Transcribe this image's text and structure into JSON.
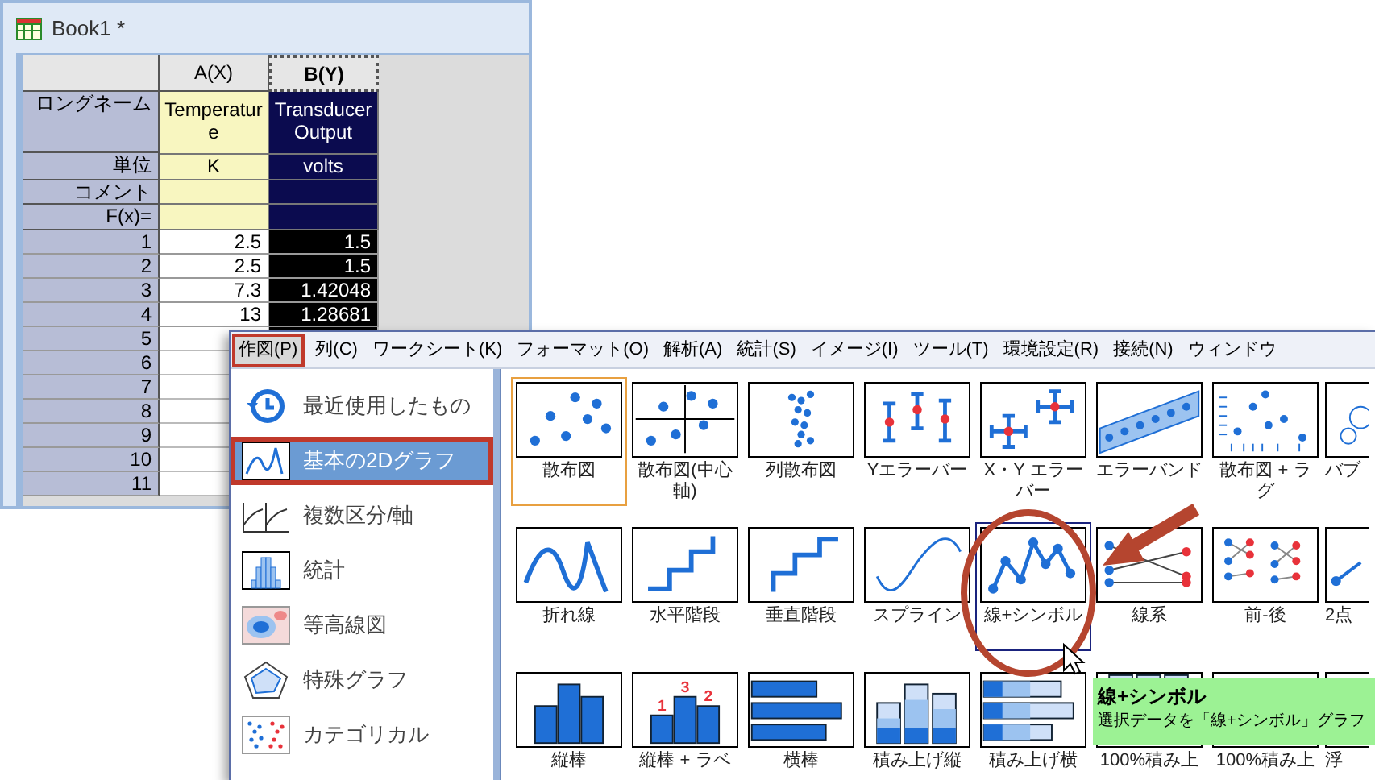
{
  "worksheet": {
    "title": "Book1 *",
    "row_labels": [
      "ロングネーム",
      "単位",
      "コメント",
      "F(x)="
    ],
    "columns": [
      {
        "name": "A(X)",
        "selected": false,
        "long_name": "Temperature",
        "units": "K",
        "values": [
          "2.5",
          "2.5",
          "7.3",
          "13"
        ]
      },
      {
        "name": "B(Y)",
        "selected": true,
        "long_name": "Transducer Output",
        "units": "volts",
        "values": [
          "1.5",
          "1.5",
          "1.42048",
          "1.28681"
        ]
      }
    ],
    "row_numbers": [
      "1",
      "2",
      "3",
      "4",
      "5",
      "6",
      "7",
      "8",
      "9",
      "10",
      "11"
    ]
  },
  "menu": {
    "items": [
      {
        "label": "作図(P)",
        "selected": true
      },
      {
        "label": "列(C)",
        "selected": false
      },
      {
        "label": "ワークシート(K)",
        "selected": false
      },
      {
        "label": "フォーマット(O)",
        "selected": false
      },
      {
        "label": "解析(A)",
        "selected": false
      },
      {
        "label": "統計(S)",
        "selected": false
      },
      {
        "label": "イメージ(I)",
        "selected": false
      },
      {
        "label": "ツール(T)",
        "selected": false
      },
      {
        "label": "環境設定(R)",
        "selected": false
      },
      {
        "label": "接続(N)",
        "selected": false
      },
      {
        "label": "ウィンドウ",
        "selected": false
      }
    ],
    "categories": [
      {
        "label": "最近使用したもの",
        "kind": "recent",
        "selected": false
      },
      {
        "label": "基本の2Dグラフ",
        "kind": "basic",
        "selected": true
      },
      {
        "label": "複数区分/軸",
        "kind": "multi",
        "selected": false
      },
      {
        "label": "統計",
        "kind": "stats",
        "selected": false
      },
      {
        "label": "等高線図",
        "kind": "contour",
        "selected": false
      },
      {
        "label": "特殊グラフ",
        "kind": "special",
        "selected": false
      },
      {
        "label": "カテゴリカル",
        "kind": "categorical",
        "selected": false
      }
    ],
    "graph_rows": [
      [
        {
          "label": "散布図",
          "kind": "scatter",
          "selected": true,
          "hovered": false
        },
        {
          "label": "散布図(中心軸)",
          "kind": "centered",
          "selected": false,
          "hovered": false
        },
        {
          "label": "列散布図",
          "kind": "columnscatter",
          "selected": false,
          "hovered": false
        },
        {
          "label": "Yエラーバー",
          "kind": "yerror",
          "selected": false,
          "hovered": false
        },
        {
          "label": "X・Y エラーバー",
          "kind": "xyerror",
          "selected": false,
          "hovered": false
        },
        {
          "label": "エラーバンド",
          "kind": "band",
          "selected": false,
          "hovered": false
        },
        {
          "label": "散布図 + ラグ",
          "kind": "rug",
          "selected": false,
          "hovered": false
        },
        {
          "label": "バブ",
          "kind": "bubble",
          "selected": false,
          "hovered": false
        }
      ],
      [
        {
          "label": "折れ線",
          "kind": "line",
          "selected": false,
          "hovered": false
        },
        {
          "label": "水平階段",
          "kind": "steph",
          "selected": false,
          "hovered": false
        },
        {
          "label": "垂直階段",
          "kind": "stepv",
          "selected": false,
          "hovered": false
        },
        {
          "label": "スプライン",
          "kind": "spline",
          "selected": false,
          "hovered": false
        },
        {
          "label": "線+シンボル",
          "kind": "linesymbol",
          "selected": false,
          "hovered": true
        },
        {
          "label": "線系",
          "kind": "lineseries",
          "selected": false,
          "hovered": false
        },
        {
          "label": "前-後",
          "kind": "beforeafter",
          "selected": false,
          "hovered": false
        },
        {
          "label": "2点",
          "kind": "twopoint",
          "selected": false,
          "hovered": false
        }
      ],
      [
        {
          "label": "縦棒",
          "kind": "column",
          "selected": false,
          "hovered": false
        },
        {
          "label": "縦棒 + ラベ",
          "kind": "columnlabel",
          "marks": [
            "1",
            "3",
            "2"
          ],
          "selected": false,
          "hovered": false
        },
        {
          "label": "横棒",
          "kind": "bar",
          "selected": false,
          "hovered": false
        },
        {
          "label": "積み上げ縦",
          "kind": "stackedcolumn",
          "selected": false,
          "hovered": false
        },
        {
          "label": "積み上げ横",
          "kind": "stackedbar",
          "selected": false,
          "hovered": false
        },
        {
          "label": "100%積み上",
          "kind": "percentcolumn",
          "selected": false,
          "hovered": false
        },
        {
          "label": "100%積み上",
          "kind": "percentbar",
          "selected": false,
          "hovered": false
        },
        {
          "label": "浮",
          "kind": "floating",
          "selected": false,
          "hovered": false
        }
      ]
    ],
    "tooltip": {
      "title": "線+シンボル",
      "text": "選択データを「線+シンボル」グラフ"
    }
  }
}
